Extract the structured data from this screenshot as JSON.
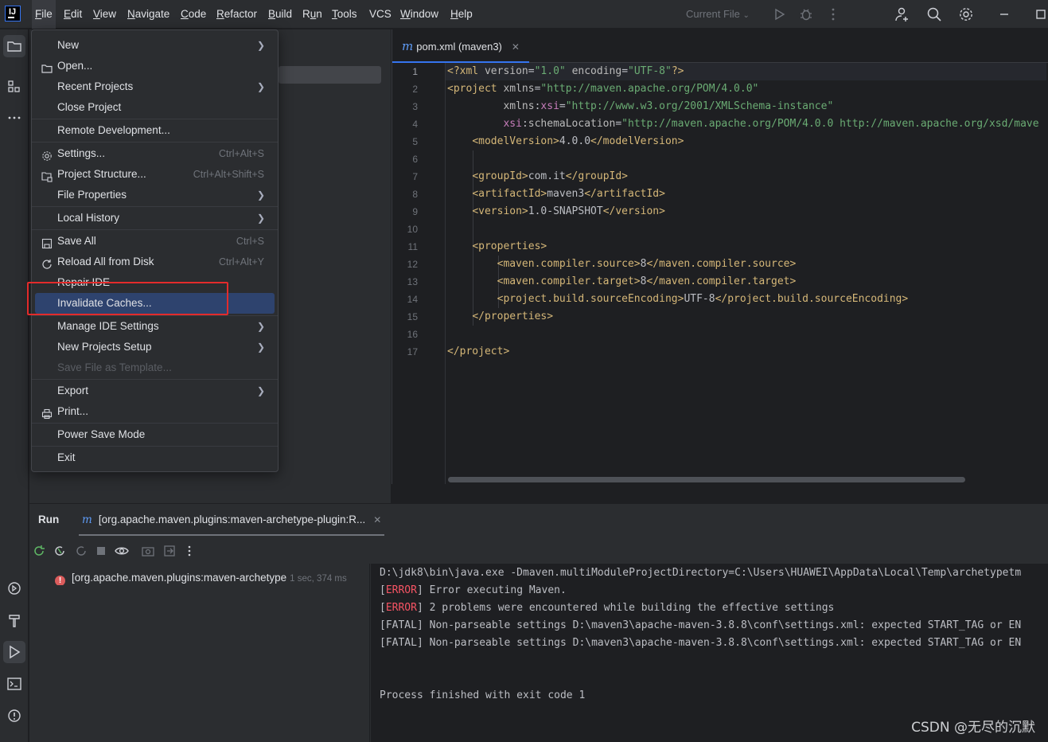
{
  "menubar": {
    "items": [
      {
        "label": "File",
        "mnemonic": "F",
        "rest": "ile"
      },
      {
        "label": "Edit",
        "mnemonic": "E",
        "rest": "dit"
      },
      {
        "label": "View",
        "mnemonic": "V",
        "rest": "iew"
      },
      {
        "label": "Navigate",
        "mnemonic": "N",
        "rest": "avigate"
      },
      {
        "label": "Code",
        "mnemonic": "C",
        "rest": "ode"
      },
      {
        "label": "Refactor",
        "mnemonic": "R",
        "rest": "efactor"
      },
      {
        "label": "Build",
        "mnemonic": "B",
        "rest": "uild"
      },
      {
        "label": "Run",
        "mnemonic": "u",
        "rest": "n"
      },
      {
        "label": "Tools",
        "mnemonic": "T",
        "rest": "ools"
      },
      {
        "label": "VCS",
        "mnemonic": "",
        "rest": "VCS"
      },
      {
        "label": "Window",
        "mnemonic": "W",
        "rest": "indow"
      },
      {
        "label": "Help",
        "mnemonic": "H",
        "rest": "elp"
      }
    ],
    "current_file": "Current File"
  },
  "file_menu": {
    "items": [
      {
        "label": "New",
        "shortcut": "",
        "submenu": true
      },
      {
        "label": "Open...",
        "shortcut": "",
        "submenu": false
      },
      {
        "label": "Recent Projects",
        "shortcut": "",
        "submenu": true
      },
      {
        "label": "Close Project",
        "shortcut": "",
        "submenu": false
      },
      {
        "label": "Remote Development...",
        "shortcut": "",
        "submenu": false
      },
      {
        "label": "Settings...",
        "shortcut": "Ctrl+Alt+S",
        "submenu": false
      },
      {
        "label": "Project Structure...",
        "shortcut": "Ctrl+Alt+Shift+S",
        "submenu": false
      },
      {
        "label": "File Properties",
        "shortcut": "",
        "submenu": true
      },
      {
        "label": "Local History",
        "shortcut": "",
        "submenu": true
      },
      {
        "label": "Save All",
        "shortcut": "Ctrl+S",
        "submenu": false
      },
      {
        "label": "Reload All from Disk",
        "shortcut": "Ctrl+Alt+Y",
        "submenu": false
      },
      {
        "label": "Repair IDE",
        "shortcut": "",
        "submenu": false
      },
      {
        "label": "Invalidate Caches...",
        "shortcut": "",
        "submenu": false
      },
      {
        "label": "Manage IDE Settings",
        "shortcut": "",
        "submenu": true
      },
      {
        "label": "New Projects Setup",
        "shortcut": "",
        "submenu": true
      },
      {
        "label": "Save File as Template...",
        "shortcut": "",
        "submenu": false
      },
      {
        "label": "Export",
        "shortcut": "",
        "submenu": true
      },
      {
        "label": "Print...",
        "shortcut": "",
        "submenu": false
      },
      {
        "label": "Power Save Mode",
        "shortcut": "",
        "submenu": false
      },
      {
        "label": "Exit",
        "shortcut": "",
        "submenu": false
      }
    ]
  },
  "editor": {
    "tab_label": "pom.xml (maven3)",
    "tab_icon": "m",
    "line_numbers": [
      "1",
      "2",
      "3",
      "4",
      "5",
      "6",
      "7",
      "8",
      "9",
      "10",
      "11",
      "12",
      "13",
      "14",
      "15",
      "16",
      "17"
    ]
  },
  "run_panel": {
    "title": "Run",
    "tab_icon": "m",
    "tab_label": "[org.apache.maven.plugins:maven-archetype-plugin:R...",
    "tree_label": "[org.apache.maven.plugins:maven-archetype",
    "tree_time": "1 sec, 374 ms",
    "console": [
      {
        "prefix": "",
        "text": "D:\\jdk8\\bin\\java.exe -Dmaven.multiModuleProjectDirectory=C:\\Users\\HUAWEI\\AppData\\Local\\Temp\\archetypetm"
      },
      {
        "prefix": "ERROR",
        "text": " Error executing Maven."
      },
      {
        "prefix": "ERROR",
        "text": " 2 problems were encountered while building the effective settings"
      },
      {
        "prefix": "",
        "text": "[FATAL] Non-parseable settings D:\\maven3\\apache-maven-3.8.8\\conf\\settings.xml: expected START_TAG or EN"
      },
      {
        "prefix": "",
        "text": "[FATAL] Non-parseable settings D:\\maven3\\apache-maven-3.8.8\\conf\\settings.xml: expected START_TAG or EN"
      },
      {
        "prefix": "",
        "text": ""
      },
      {
        "prefix": "",
        "text": ""
      },
      {
        "prefix": "",
        "text": "Process finished with exit code 1"
      }
    ]
  },
  "watermark": "CSDN @无尽的沉默",
  "colors": {
    "accent": "#3574f0",
    "highlight": "#2e436e",
    "annotation": "#e32b2b",
    "error": "#f75464"
  }
}
